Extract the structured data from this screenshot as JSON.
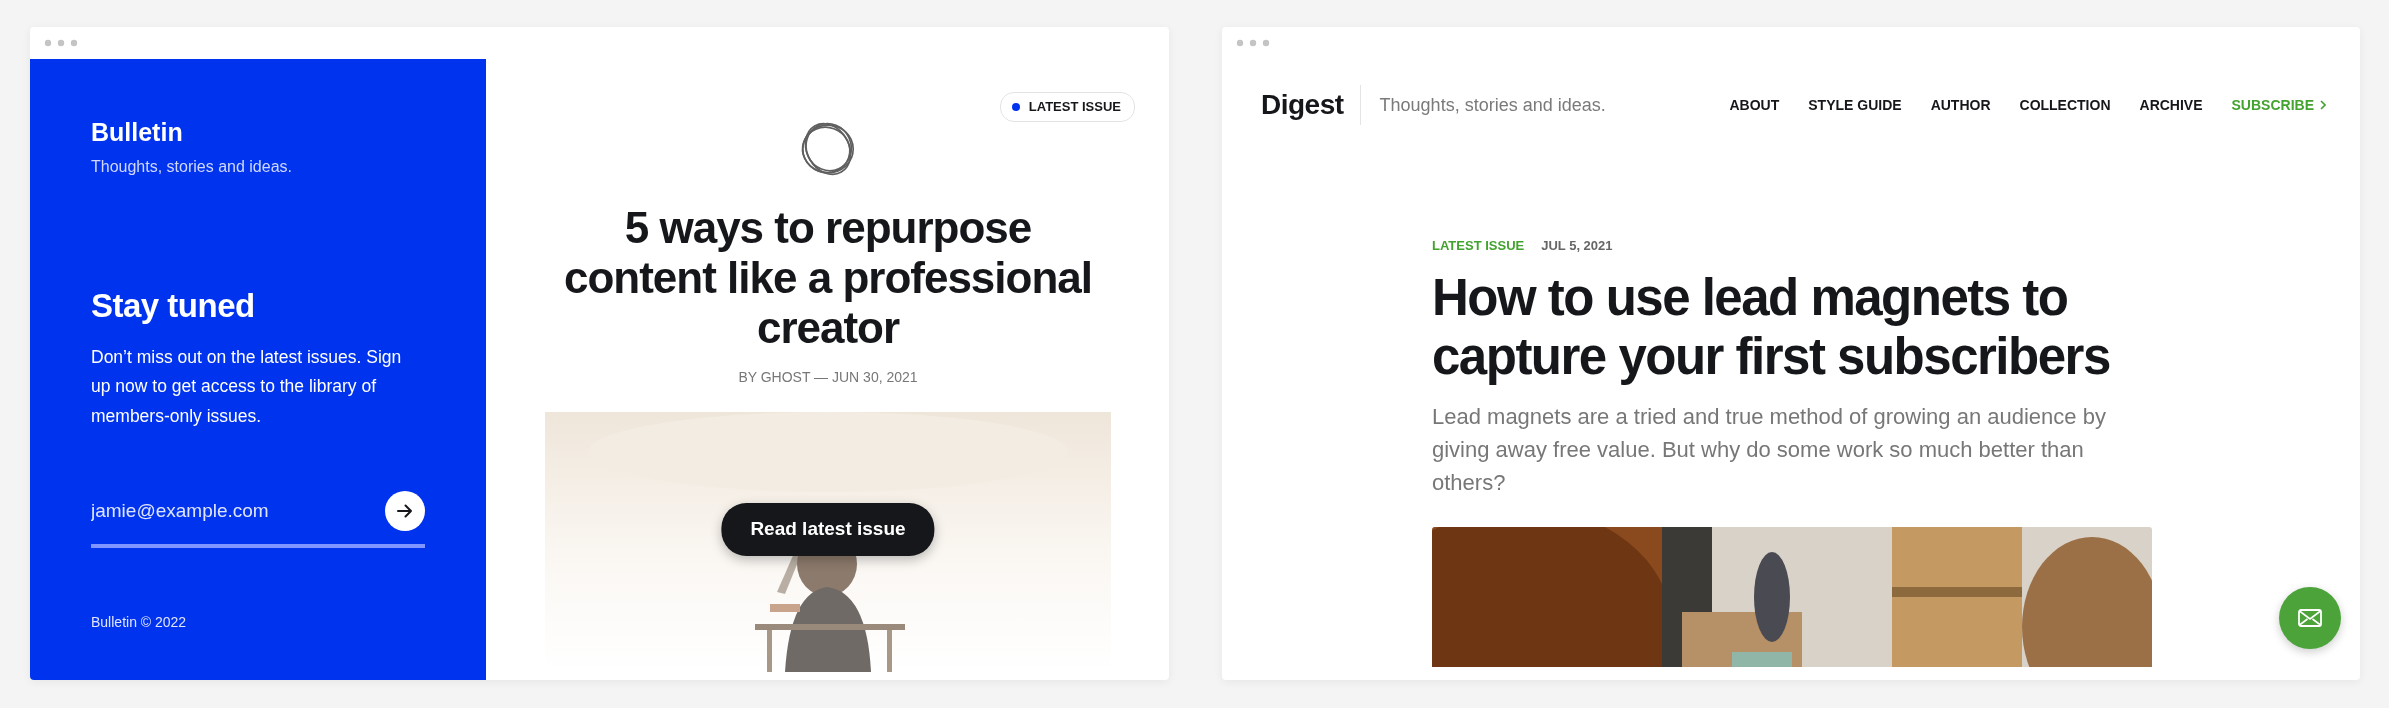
{
  "bulletin_window": {
    "sidebar": {
      "brand": "Bulletin",
      "tagline": "Thoughts, stories and ideas.",
      "heading": "Stay tuned",
      "text": "Don’t miss out on the latest issues. Sign up now to get access to the library of members-only issues.",
      "email": {
        "placeholder": "jamie@example.com"
      },
      "footer": "Bulletin © 2022"
    },
    "badge": {
      "label": "LATEST ISSUE",
      "color": "#0033ee"
    },
    "post": {
      "title": "5 ways to repurpose content like a professional creator",
      "byline": "BY GHOST — JUN 30, 2021",
      "button": "Read latest issue"
    }
  },
  "digest_window": {
    "brand": "Digest",
    "tagline": "Thoughts, stories and ideas.",
    "nav": [
      {
        "label": "ABOUT",
        "kind": "link"
      },
      {
        "label": "STYLE GUIDE",
        "kind": "link"
      },
      {
        "label": "AUTHOR",
        "kind": "link"
      },
      {
        "label": "COLLECTION",
        "kind": "link"
      },
      {
        "label": "ARCHIVE",
        "kind": "link"
      },
      {
        "label": "SUBSCRIBE",
        "kind": "cta"
      }
    ],
    "post": {
      "tag": "LATEST ISSUE",
      "date": "JUL 5, 2021",
      "title": "How to use lead magnets to capture your first subscribers",
      "excerpt": "Lead magnets are a tried and true method of growing an audience by giving away free value. But why do some work so much better than others?"
    }
  }
}
